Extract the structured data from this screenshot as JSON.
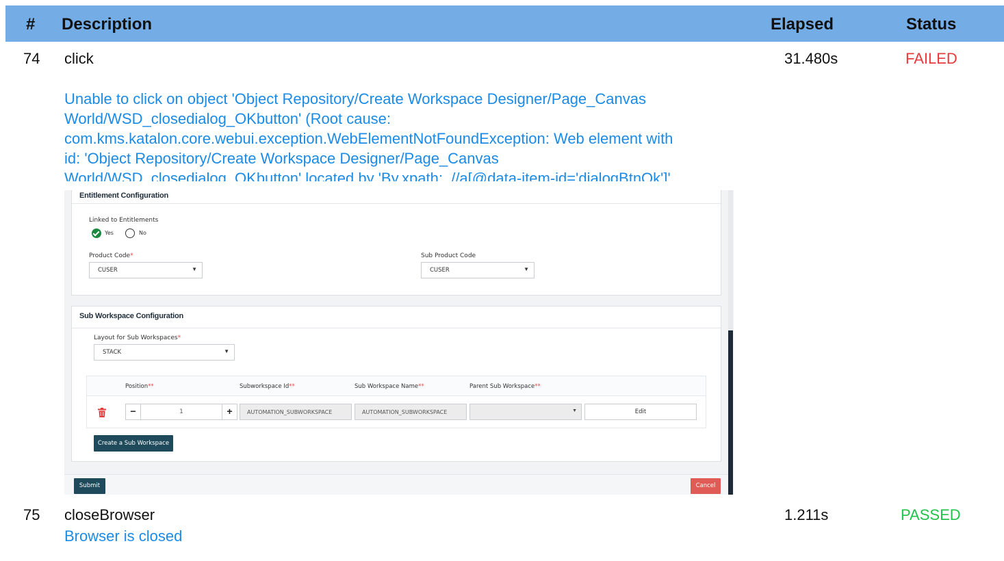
{
  "report": {
    "headers": {
      "num": "#",
      "description": "Description",
      "elapsed": "Elapsed",
      "status": "Status"
    },
    "rows": [
      {
        "num": "74",
        "description": "click",
        "elapsed": "31.480s",
        "status": "FAILED",
        "message_lines": [
          "Unable to click on object 'Object Repository/Create Workspace Designer/Page_Canvas",
          "World/WSD_closedialog_OKbutton' (Root cause:",
          "com.kms.katalon.core.webui.exception.WebElementNotFoundException: Web element with",
          "id: 'Object Repository/Create Workspace Designer/Page_Canvas",
          "World/WSD_closedialog_OKbutton' located by 'By.xpath: .//a[@data-item-id='dialogBtnOk']'"
        ]
      },
      {
        "num": "75",
        "description": "closeBrowser",
        "elapsed": "1.211s",
        "status": "PASSED",
        "message_lines": [
          "Browser is closed"
        ]
      }
    ],
    "colors": {
      "header_bg": "#74ade6",
      "failed": "#e8393b",
      "passed": "#22c24a",
      "message": "#1b8be6"
    }
  },
  "screenshot": {
    "entitlement": {
      "title": "Entitlement Configuration",
      "linked_label": "Linked to Entitlements",
      "yes_label": "Yes",
      "no_label": "No",
      "product_code_label": "Product Code",
      "product_code_value": "CUSER",
      "sub_product_code_label": "Sub Product Code",
      "sub_product_code_value": "CUSER"
    },
    "sub_workspace": {
      "title": "Sub Workspace Configuration",
      "layout_label": "Layout for Sub Workspaces",
      "layout_value": "STACK",
      "columns": {
        "position": "Position",
        "subworkspace_id": "Subworkspace Id",
        "sub_workspace_name": "Sub Workspace Name",
        "parent_sub_workspace": "Parent Sub Workspace"
      },
      "row": {
        "position_value": "1",
        "subworkspace_id": "AUTOMATION_SUBWORKSPACE",
        "sub_workspace_name": "AUTOMATION_SUBWORKSPACE",
        "parent_sub_workspace": "",
        "edit_label": "Edit"
      },
      "create_button": "Create a Sub Workspace"
    },
    "footer": {
      "submit": "Submit",
      "cancel": "Cancel"
    },
    "required_single": "*",
    "required_double": "**",
    "icons": {
      "minus": "−",
      "plus": "+",
      "caret": "▼"
    }
  }
}
